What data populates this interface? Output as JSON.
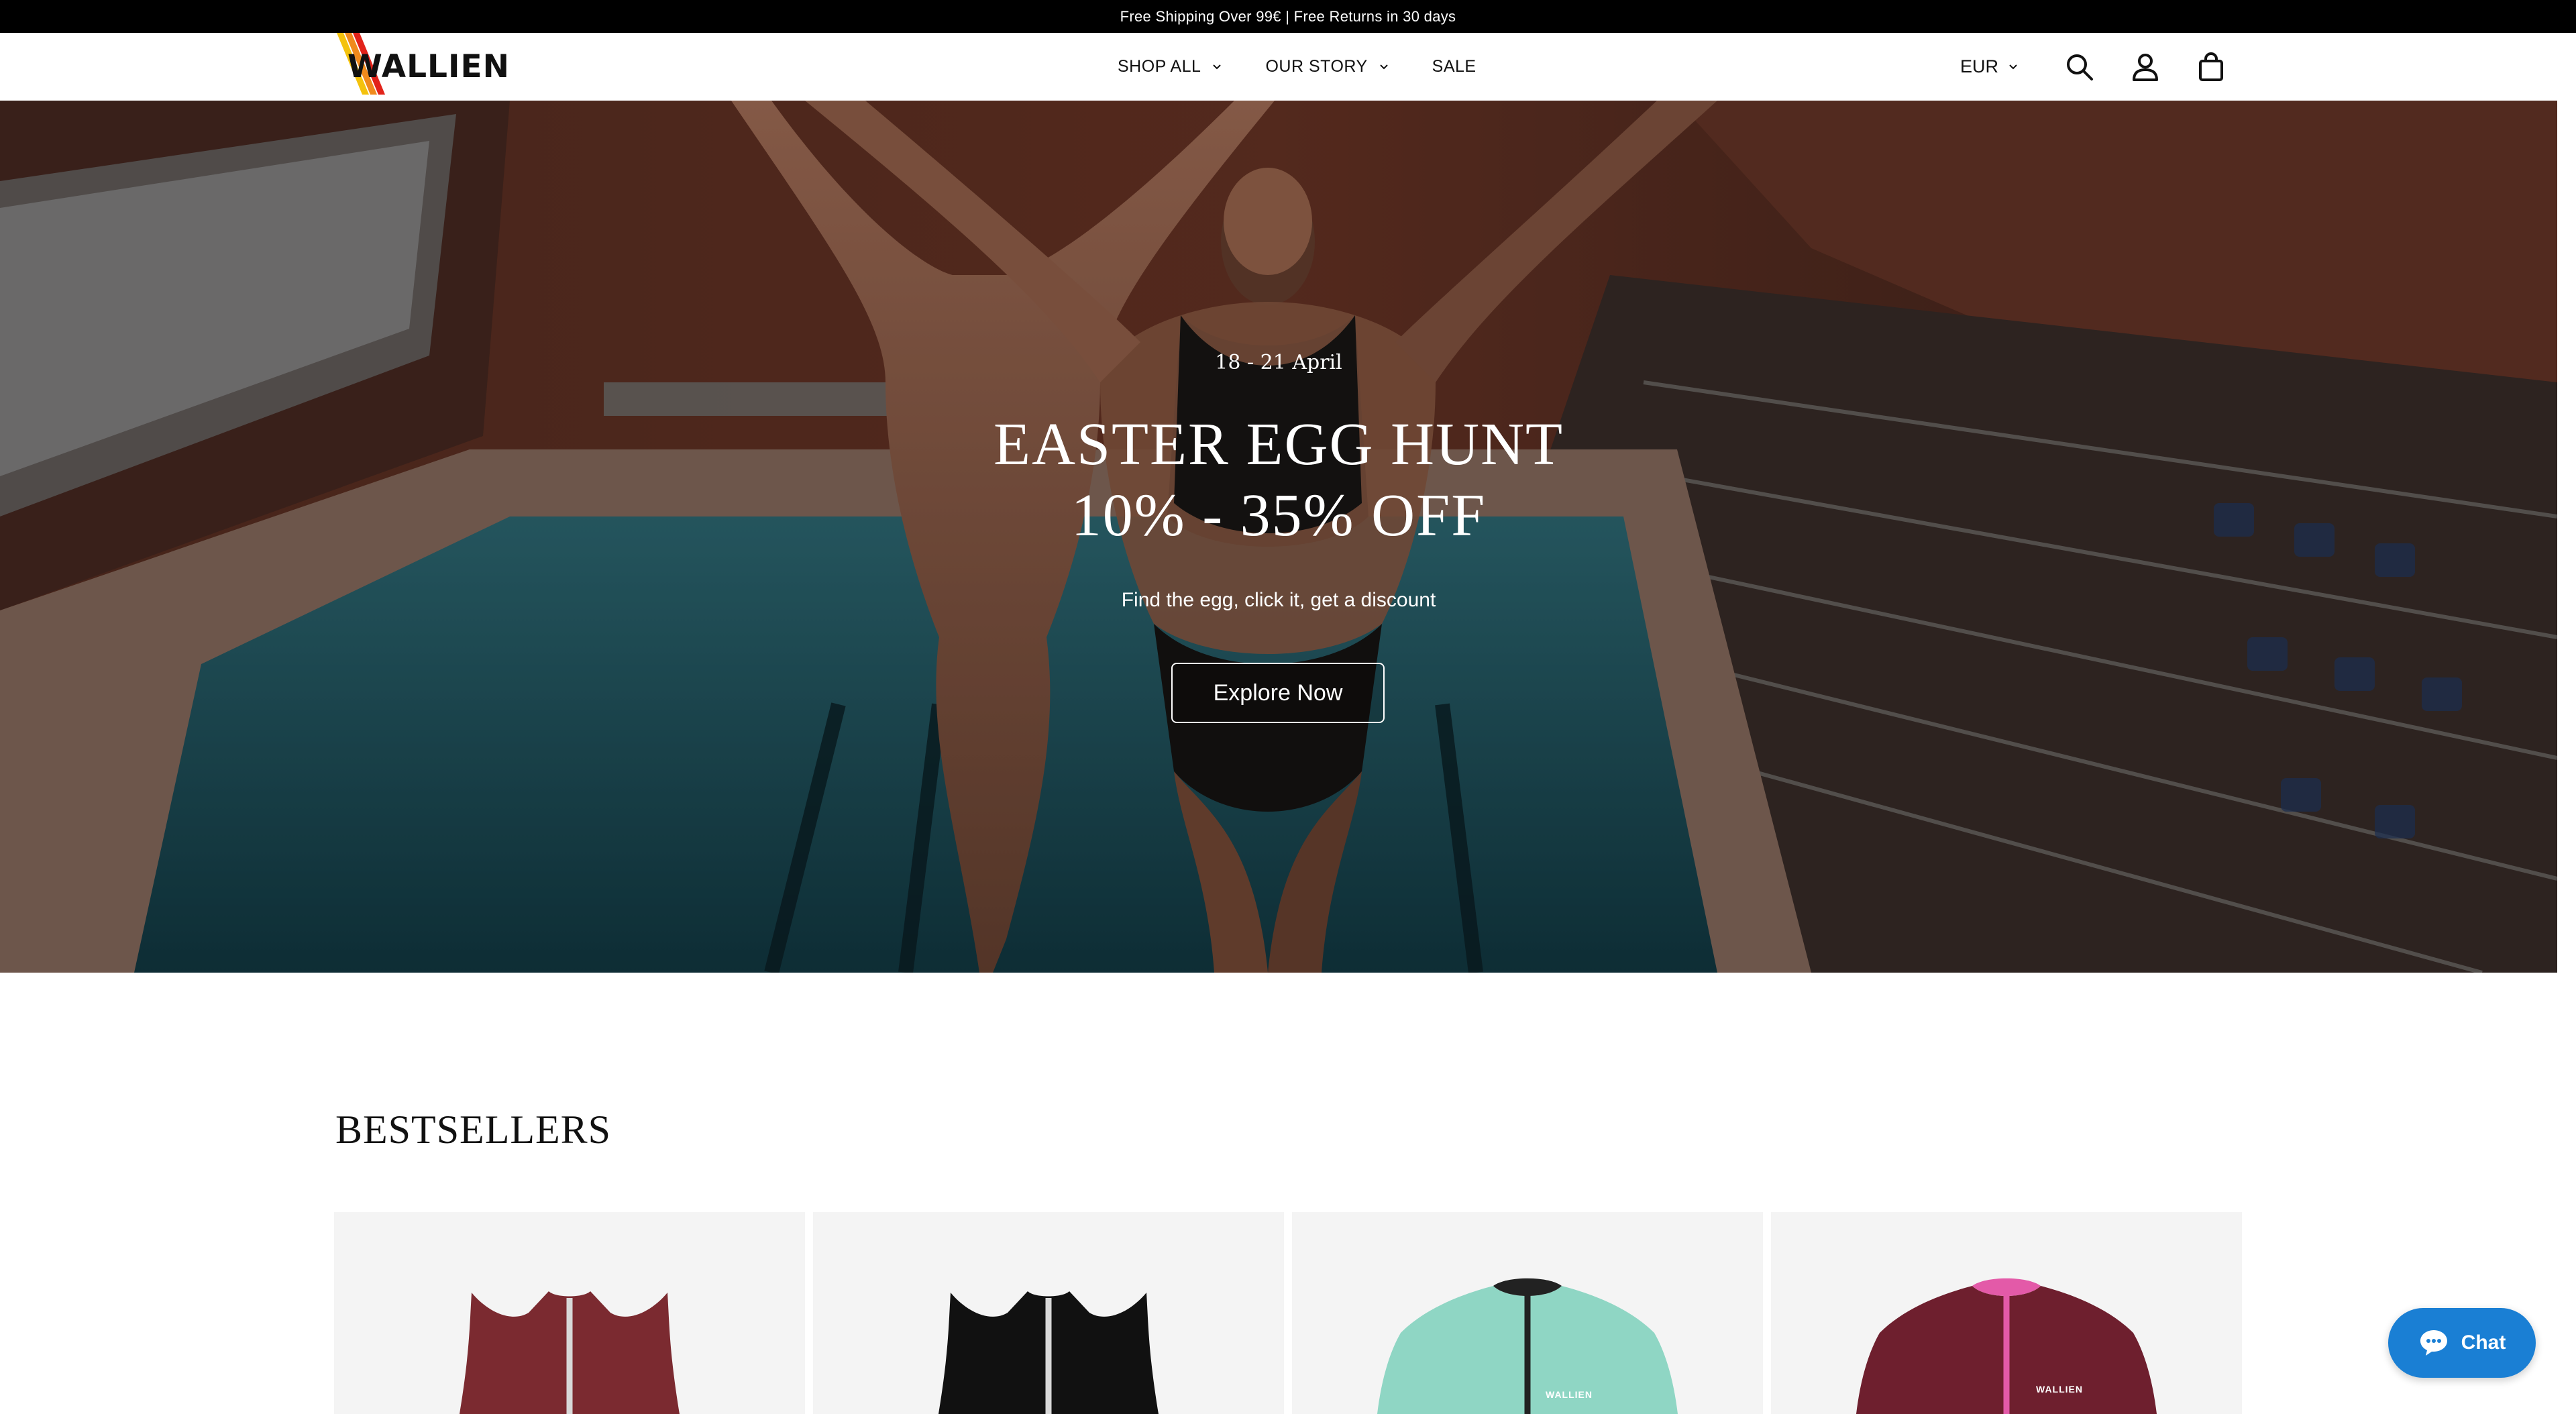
{
  "announcement": {
    "text": "Free Shipping Over 99€ | Free Returns in 30 days"
  },
  "header": {
    "logo_text": "WALLIEN",
    "nav": [
      {
        "label": "SHOP ALL",
        "has_dropdown": true
      },
      {
        "label": "OUR STORY",
        "has_dropdown": true
      },
      {
        "label": "SALE",
        "has_dropdown": false
      }
    ],
    "currency": "EUR",
    "icons": [
      "search-icon",
      "account-icon",
      "cart-icon"
    ]
  },
  "hero": {
    "date": "18 - 21 April",
    "title_line1": "EASTER EGG HUNT",
    "title_line2": "10% - 35% OFF",
    "subtitle": "Find the egg, click it, get a discount",
    "cta": "Explore Now"
  },
  "bestsellers": {
    "title": "BESTSELLERS",
    "products": [
      {
        "color": "#7b2a30",
        "style": "sleeveless-zip",
        "zip": "#d8d8d8"
      },
      {
        "color": "#111111",
        "style": "sleeveless-zip",
        "zip": "#d8d8d8"
      },
      {
        "color": "#8fd6c4",
        "style": "longsleeve-zip",
        "zip": "#222222",
        "brand": "WALLIEN"
      },
      {
        "color": "#6e1f2e",
        "style": "longsleeve-zip",
        "zip": "#e35aa8",
        "brand": "WALLIEN"
      }
    ]
  },
  "chat": {
    "label": "Chat"
  },
  "colors": {
    "announcement_bg": "#000000",
    "chat_bg": "#1a7fd4",
    "card_bg": "#f4f4f4"
  }
}
